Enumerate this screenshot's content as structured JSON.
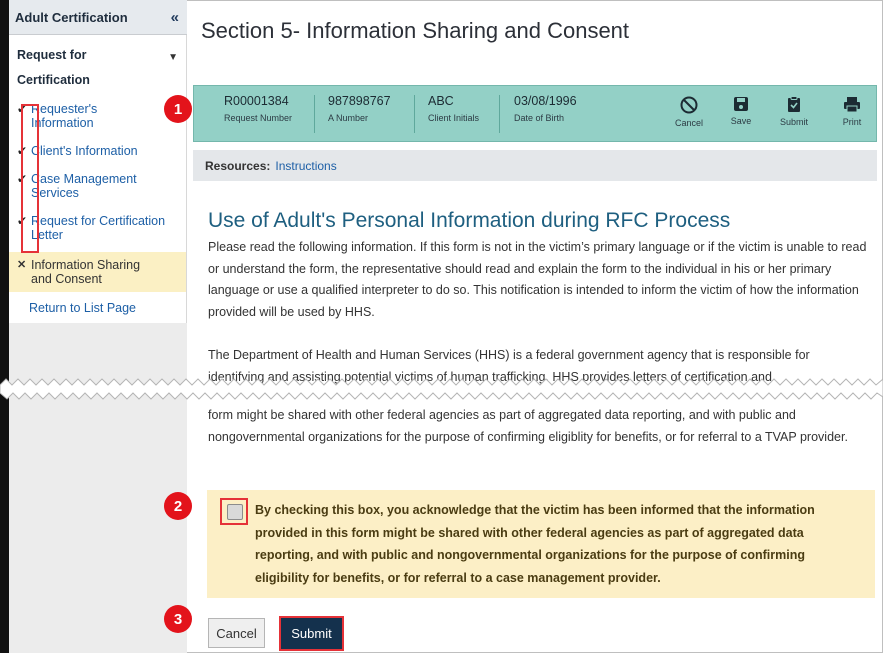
{
  "sidebar": {
    "title": "Adult Certification",
    "collapse_glyph": "«",
    "section_title": "Request for Certification",
    "items": [
      {
        "label": "Requester's Information",
        "status": "check-icon"
      },
      {
        "label": "Client's Information",
        "status": "check-icon"
      },
      {
        "label": "Case Management Services",
        "status": "check-icon"
      },
      {
        "label": "Request for Certification Letter",
        "status": "check-icon"
      }
    ],
    "active_item": {
      "label": "Information Sharing and Consent",
      "status": "x-icon"
    },
    "return_link": "Return to List Page"
  },
  "page": {
    "title": "Section 5- Information Sharing and Consent"
  },
  "infobar": {
    "fields": [
      {
        "value": "R00001384",
        "label": "Request Number"
      },
      {
        "value": "987898767",
        "label": "A Number"
      },
      {
        "value": "ABC",
        "label": "Client Initials"
      },
      {
        "value": "03/08/1996",
        "label": "Date of Birth"
      }
    ],
    "actions": [
      {
        "label": "Cancel",
        "icon": "cancel-icon"
      },
      {
        "label": "Save",
        "icon": "save-icon"
      },
      {
        "label": "Submit",
        "icon": "submit-icon"
      },
      {
        "label": "Print",
        "icon": "print-icon"
      }
    ]
  },
  "resources": {
    "label": "Resources:",
    "link": "Instructions"
  },
  "content": {
    "heading": "Use of Adult's Personal Information during RFC Process",
    "paragraph1": "Please read the following information. If this form is not in the victim’s primary language or if the victim is unable to read or understand the form, the representative should read and explain the form to the individual in his or her primary language or use a qualified interpreter to do so. This notification is intended to inform the victim of how the information provided will be used by HHS.",
    "paragraph2_start": "The Department of Health and Human Services (HHS) is a federal government agency that is responsible for identifying and assisting potential victims of human trafficking. HHS provides letters of certification and",
    "paragraph2_end": "form might be shared with other federal agencies as part of aggregated data reporting, and with public and nongovernmental organizations for the purpose of confirming eligiblity for benefits, or for referral to a TVAP provider."
  },
  "consent": {
    "checked": false,
    "text": "By checking this box, you acknowledge that the victim has been informed that the information provided in this form might be shared with other federal agencies as part of aggregated data reporting, and with public and nongovernmental organizations for the purpose of confirming eligibility for benefits, or for referral to a case management provider."
  },
  "buttons": {
    "cancel": "Cancel",
    "submit": "Submit"
  },
  "markers": [
    "1",
    "2",
    "3"
  ],
  "colors": {
    "infobar_bg": "#93d0c6",
    "consent_bg": "#fcefc6",
    "submit_bg": "#14314d",
    "highlight_red": "#e53238",
    "link": "#1d5fa6"
  }
}
